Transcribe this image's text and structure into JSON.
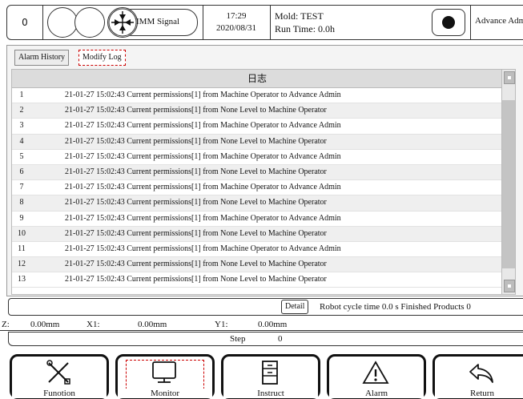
{
  "header": {
    "counter": "0",
    "signal_label": "IMM Signal",
    "time": "17:29",
    "date": "2020/08/31",
    "mold_label": "Mold: TEST",
    "run_time": "Run Time: 0.0h",
    "user": "Advance Admi"
  },
  "tabs": [
    {
      "label": "Alarm History"
    },
    {
      "label": "Modify Log"
    }
  ],
  "table": {
    "header": "日志",
    "rows": [
      {
        "idx": "1",
        "text": "21-01-27 15:02:43 Current permissions[1] from Machine Operator to Advance Admin"
      },
      {
        "idx": "2",
        "text": "21-01-27 15:02:43 Current permissions[1] from None Level to Machine Operator"
      },
      {
        "idx": "3",
        "text": "21-01-27 15:02:43 Current permissions[1] from Machine Operator to Advance Admin"
      },
      {
        "idx": "4",
        "text": "21-01-27 15:02:43 Current permissions[1] from None Level to Machine Operator"
      },
      {
        "idx": "5",
        "text": "21-01-27 15:02:43 Current permissions[1] from Machine Operator to Advance Admin"
      },
      {
        "idx": "6",
        "text": "21-01-27 15:02:43 Current permissions[1] from None Level to Machine Operator"
      },
      {
        "idx": "7",
        "text": "21-01-27 15:02:43 Current permissions[1] from Machine Operator to Advance Admin"
      },
      {
        "idx": "8",
        "text": "21-01-27 15:02:43 Current permissions[1] from None Level to Machine Operator"
      },
      {
        "idx": "9",
        "text": "21-01-27 15:02:43 Current permissions[1] from Machine Operator to Advance Admin"
      },
      {
        "idx": "10",
        "text": "21-01-27 15:02:43 Current permissions[1] from None Level to Machine Operator"
      },
      {
        "idx": "11",
        "text": "21-01-27 15:02:43 Current permissions[1] from Machine Operator to Advance Admin"
      },
      {
        "idx": "12",
        "text": "21-01-27 15:02:43 Current permissions[1] from None Level to Machine Operator"
      },
      {
        "idx": "13",
        "text": "21-01-27 15:02:43 Current permissions[1] from None Level to Machine Operator"
      }
    ]
  },
  "status": {
    "detail_label": "Detail",
    "message": "Robot cycle time 0.0 s Finished Products 0"
  },
  "coords": {
    "z_label": "Z:",
    "z_value": "0.00mm",
    "x1_label": "X1:",
    "x1_value": "0.00mm",
    "y1_label": "Y1:",
    "y1_value": "0.00mm"
  },
  "step": {
    "label": "Step",
    "value": "0"
  },
  "nav": [
    {
      "label": "Funotion",
      "icon": "tools-icon"
    },
    {
      "label": "Monitor",
      "icon": "monitor-icon"
    },
    {
      "label": "Instruct",
      "icon": "cabinet-icon"
    },
    {
      "label": "Alarm",
      "icon": "warning-icon"
    },
    {
      "label": "Return",
      "icon": "return-icon"
    }
  ]
}
